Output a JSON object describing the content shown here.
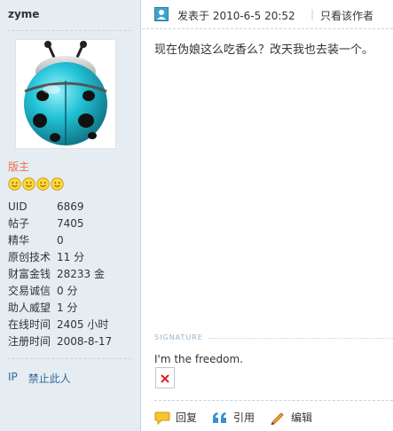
{
  "user": {
    "name": "zyme",
    "group": "版主",
    "stars": 4,
    "stats": [
      {
        "label": "UID",
        "value": "6869"
      },
      {
        "label": "帖子",
        "value": "7405"
      },
      {
        "label": "精华",
        "value": "0"
      },
      {
        "label": "原创技术",
        "value": "11 分"
      },
      {
        "label": "财富金钱",
        "value": "28233 金"
      },
      {
        "label": "交易诚信",
        "value": "0 分"
      },
      {
        "label": "助人威望",
        "value": "1 分"
      },
      {
        "label": "在线时间",
        "value": "2405 小时"
      },
      {
        "label": "注册时间",
        "value": "2008-8-17"
      }
    ],
    "links": {
      "ip": "IP",
      "ban": "禁止此人"
    }
  },
  "post": {
    "posted_at": "发表于  2010-6-5 20:52",
    "separator": "|",
    "only_author": "只看该作者",
    "content": "现在伪娘这么吃香么？改天我也去装一个。",
    "signature_label": "SIGNATURE",
    "signature_text": "I'm the freedom."
  },
  "actions": {
    "reply": "回复",
    "quote": "引用",
    "edit": "编辑"
  },
  "colors": {
    "sidebar_bg": "#e5edf2",
    "link": "#336699",
    "group": "#f26c4f",
    "avatar_body": "#25c4d8"
  }
}
